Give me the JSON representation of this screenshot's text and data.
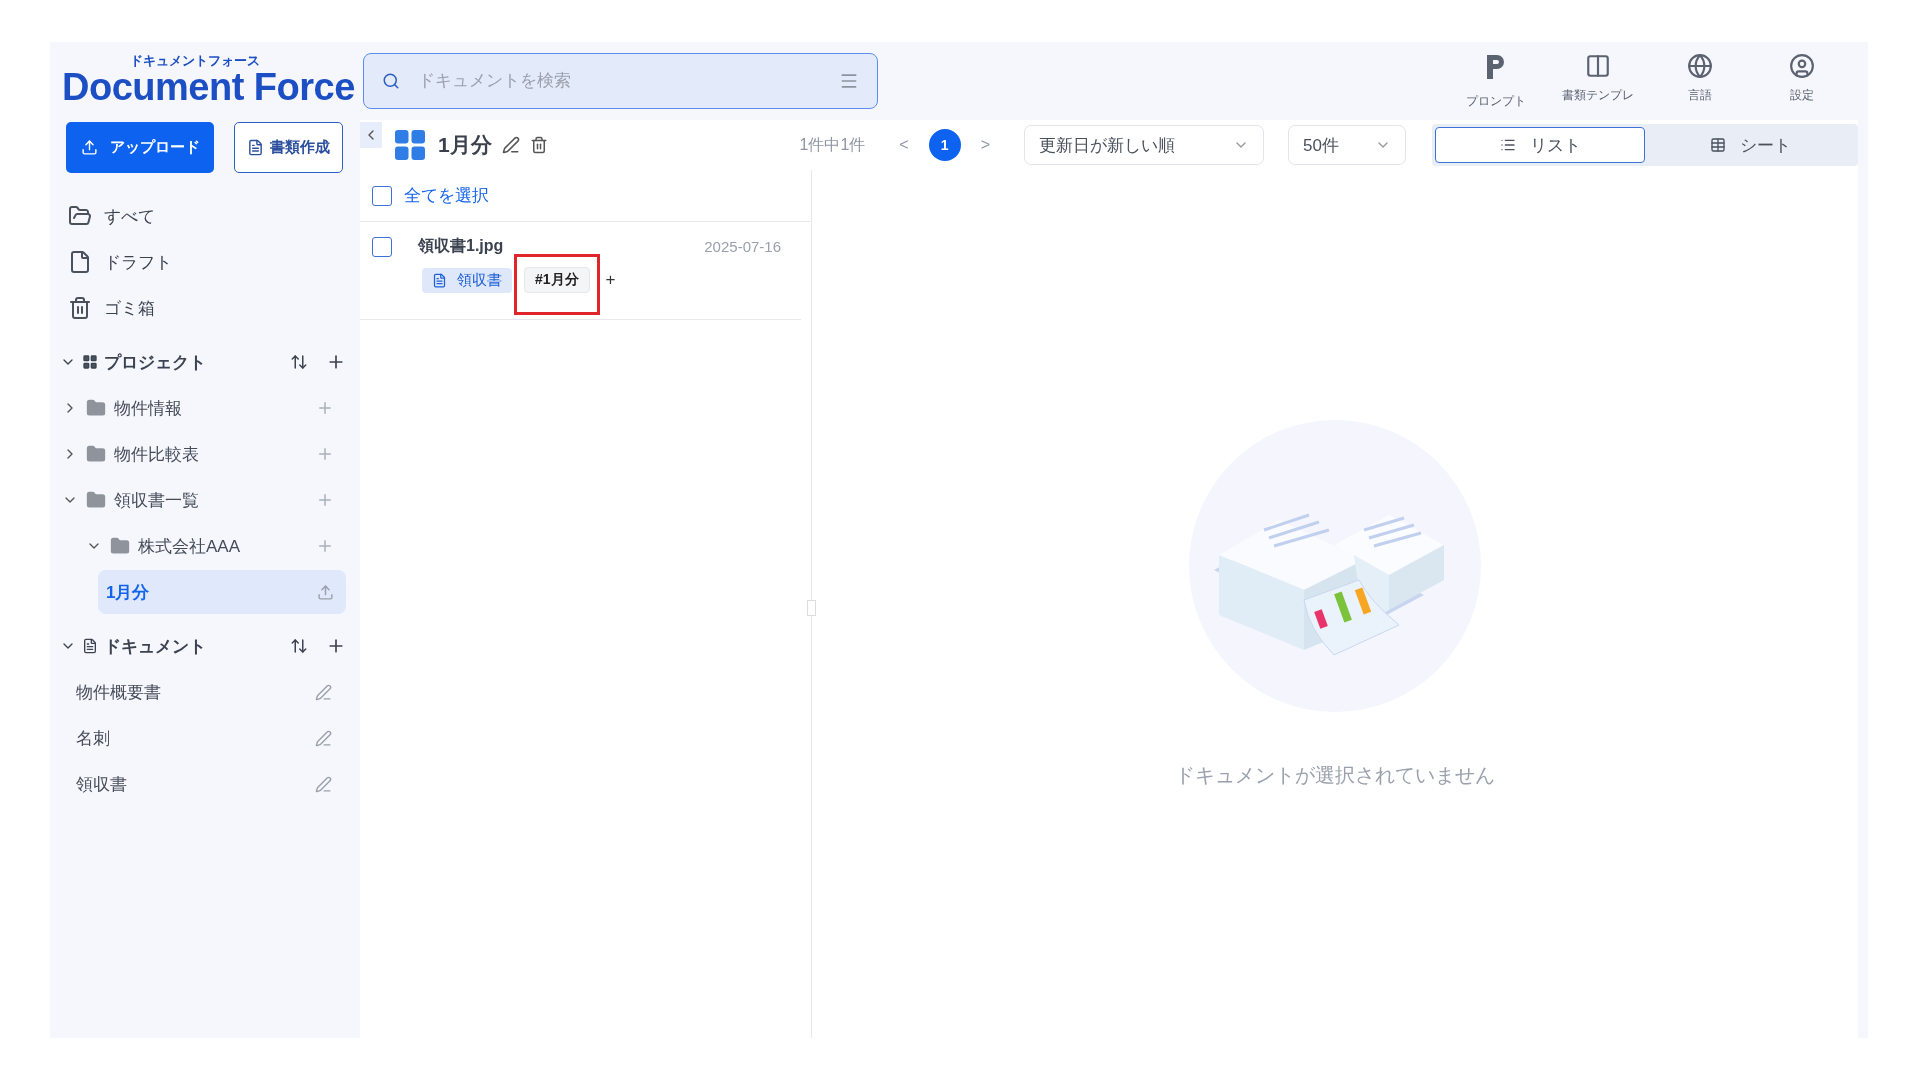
{
  "logo": {
    "kana": "ドキュメントフォース",
    "name": "Document Force"
  },
  "search": {
    "placeholder": "ドキュメントを検索"
  },
  "header_actions": [
    {
      "kind": "prompt",
      "label": "プロンプト"
    },
    {
      "kind": "template",
      "label": "書類テンプレ"
    },
    {
      "kind": "language",
      "label": "言語"
    },
    {
      "kind": "settings",
      "label": "設定"
    }
  ],
  "sidebar": {
    "upload_button": "アップロード",
    "create_button": "書類作成",
    "nav": [
      {
        "kind": "all",
        "label": "すべて"
      },
      {
        "kind": "draft",
        "label": "ドラフト"
      },
      {
        "kind": "trash",
        "label": "ゴミ箱"
      }
    ],
    "projects": {
      "title": "プロジェクト",
      "expanded": true,
      "items": [
        {
          "label": "物件情報",
          "expanded": false,
          "selected": false
        },
        {
          "label": "物件比較表",
          "expanded": false,
          "selected": false
        },
        {
          "label": "領収書一覧",
          "expanded": true,
          "selected": false,
          "children": [
            {
              "label": "株式会社AAA",
              "expanded": true,
              "selected": false,
              "children": [
                {
                  "label": "1月分",
                  "selected": true
                }
              ]
            }
          ]
        }
      ]
    },
    "documents": {
      "title": "ドキュメント",
      "expanded": true,
      "items": [
        "物件概要書",
        "名刺",
        "領収書"
      ]
    }
  },
  "toolbar": {
    "folder_title": "1月分",
    "count": "1件中1件",
    "prev": "<",
    "next": ">",
    "pages": [
      {
        "label": "1",
        "selected": true
      }
    ],
    "sort": "更新日が新しい順",
    "page_size": "50件",
    "views": [
      {
        "kind": "list",
        "label": "リスト",
        "selected": true
      },
      {
        "kind": "sheet",
        "label": "シート",
        "selected": false
      }
    ]
  },
  "list": {
    "select_all": {
      "label": "全てを選択",
      "checked": false
    },
    "documents": [
      {
        "name": "領収書1.jpg",
        "date": "2025-07-16",
        "checked": false,
        "type_tag": "領収書",
        "tags": [
          {
            "label": "#1月分",
            "highlighted": true
          }
        ],
        "add_tag": "+"
      }
    ]
  },
  "detail": {
    "empty_message": "ドキュメントが選択されていません"
  }
}
